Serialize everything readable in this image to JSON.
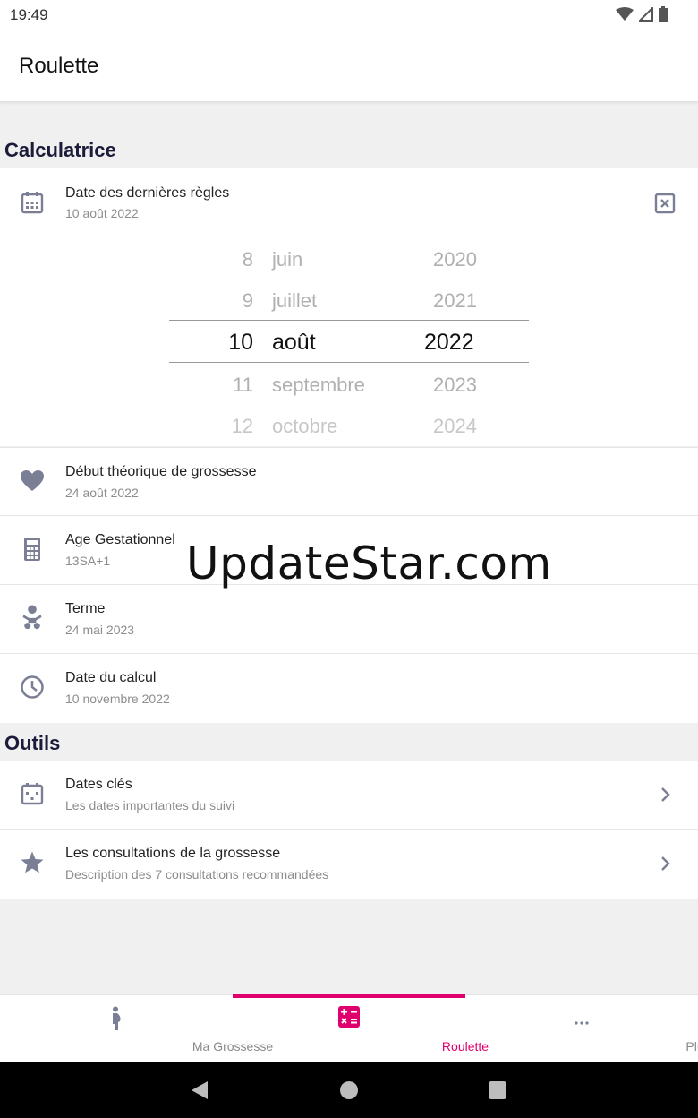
{
  "status_bar": {
    "time": "19:49"
  },
  "app_bar": {
    "title": "Roulette"
  },
  "sections": {
    "calculator": "Calculatrice",
    "tools": "Outils"
  },
  "last_period": {
    "title": "Date des dernières règles",
    "value": "10 août 2022",
    "clear_icon": "close-box-icon"
  },
  "picker": {
    "days": [
      "8",
      "9",
      "10",
      "11",
      "12"
    ],
    "months": [
      "juin",
      "juillet",
      "août",
      "septembre",
      "octobre"
    ],
    "years": [
      "2020",
      "2021",
      "2022",
      "2023",
      "2024"
    ],
    "selected_index": 2
  },
  "rows": [
    {
      "title": "Début théorique de grossesse",
      "sub": "24 août 2022",
      "icon": "heart-icon"
    },
    {
      "title": "Age Gestationnel",
      "sub": "13SA+1",
      "icon": "calculator-icon"
    },
    {
      "title": "Terme",
      "sub": "24 mai 2023",
      "icon": "baby-icon"
    },
    {
      "title": "Date du calcul",
      "sub": "10 novembre 2022",
      "icon": "clock-icon"
    }
  ],
  "tools": [
    {
      "title": "Dates clés",
      "sub": "Les dates importantes du suivi",
      "icon": "calendar-icon"
    },
    {
      "title": "Les consultations de la grossesse",
      "sub": "Description des 7 consultations recommandées",
      "icon": "star-icon"
    }
  ],
  "watermark": "UpdateStar.com",
  "bottom_nav": [
    {
      "label": "Ma Grossesse",
      "icon": "pregnant-icon"
    },
    {
      "label": "Roulette",
      "icon": "calculator-icon",
      "active": true
    },
    {
      "label": "Plus",
      "icon": "more-icon"
    }
  ],
  "colors": {
    "accent": "#e0006d",
    "icon_gray": "#7a7f95",
    "section_title": "#1b1b3a"
  }
}
